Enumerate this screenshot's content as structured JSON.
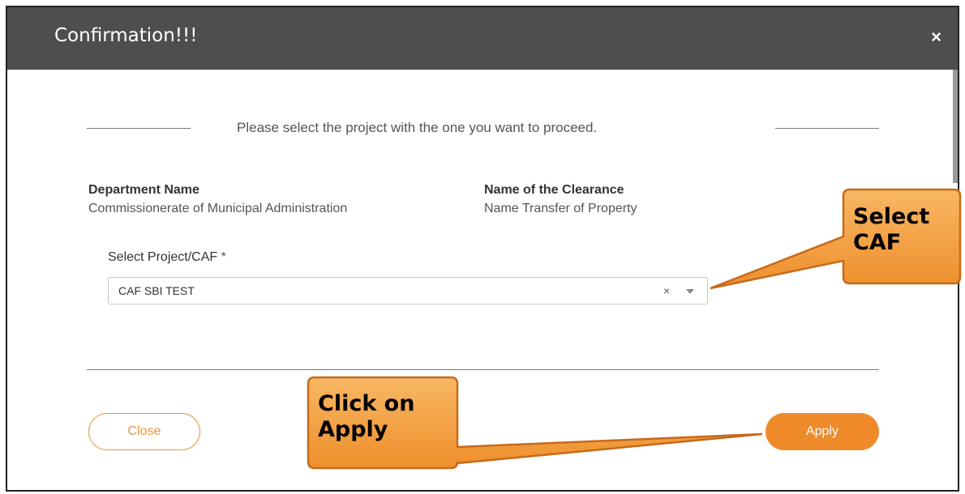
{
  "modal": {
    "title": "Confirmation!!!",
    "close_icon": "×"
  },
  "instruction": "Please select the project with the one you want to proceed.",
  "department": {
    "label": "Department Name",
    "value": "Commissionerate of Municipal Administration"
  },
  "clearance": {
    "label": "Name of the Clearance",
    "value": "Name Transfer of Property"
  },
  "project_select": {
    "label": "Select Project/CAF",
    "required_mark": "*",
    "value": "CAF SBI TEST",
    "clear_icon": "×"
  },
  "buttons": {
    "close": "Close",
    "apply": "Apply"
  },
  "callouts": {
    "select_caf": {
      "line1": "Select",
      "line2": "CAF"
    },
    "apply": {
      "line1": "Click on",
      "line2": "Apply"
    }
  },
  "colors": {
    "header_bg": "#4e4e4e",
    "accent": "#ef8a2b",
    "callout_fill": "#f5a34b",
    "callout_border": "#c66a1a"
  }
}
